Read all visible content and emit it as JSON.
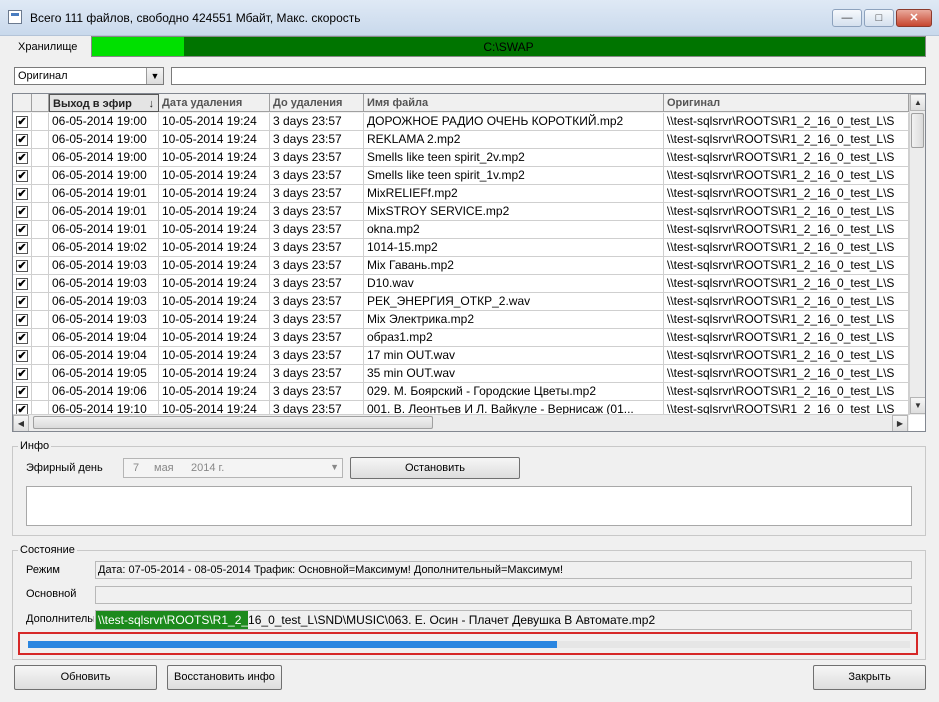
{
  "window": {
    "title": "Всего 111 файлов, свободно 424551 Мбайт, Макс. скорость"
  },
  "storage": {
    "label": "Хранилище",
    "path": "C:\\SWAP",
    "used_fraction": 0.11,
    "colors": {
      "used": "#00e000",
      "free": "#007400"
    }
  },
  "filter": {
    "selected": "Оригинал",
    "text": ""
  },
  "grid": {
    "columns": [
      "",
      "Выход в эфир",
      "Дата удаления",
      "До удаления",
      "Имя файла",
      "Оригинал"
    ],
    "sorted_column": "Выход в эфир",
    "rows": [
      [
        "06-05-2014  19:00",
        "10-05-2014  19:24",
        "3 days 23:57",
        "ДОРОЖНОЕ РАДИО ОЧЕНЬ КОРОТКИЙ.mp2",
        "\\\\test-sqlsrvr\\ROOTS\\R1_2_16_0_test_L\\S"
      ],
      [
        "06-05-2014  19:00",
        "10-05-2014  19:24",
        "3 days 23:57",
        "REKLAMA 2.mp2",
        "\\\\test-sqlsrvr\\ROOTS\\R1_2_16_0_test_L\\S"
      ],
      [
        "06-05-2014  19:00",
        "10-05-2014  19:24",
        "3 days 23:57",
        "Smells like teen spirit_2v.mp2",
        "\\\\test-sqlsrvr\\ROOTS\\R1_2_16_0_test_L\\S"
      ],
      [
        "06-05-2014  19:00",
        "10-05-2014  19:24",
        "3 days 23:57",
        "Smells like teen spirit_1v.mp2",
        "\\\\test-sqlsrvr\\ROOTS\\R1_2_16_0_test_L\\S"
      ],
      [
        "06-05-2014  19:01",
        "10-05-2014  19:24",
        "3 days 23:57",
        "MixRELIEFf.mp2",
        "\\\\test-sqlsrvr\\ROOTS\\R1_2_16_0_test_L\\S"
      ],
      [
        "06-05-2014  19:01",
        "10-05-2014  19:24",
        "3 days 23:57",
        "MixSTROY SERVICE.mp2",
        "\\\\test-sqlsrvr\\ROOTS\\R1_2_16_0_test_L\\S"
      ],
      [
        "06-05-2014  19:01",
        "10-05-2014  19:24",
        "3 days 23:57",
        "okna.mp2",
        "\\\\test-sqlsrvr\\ROOTS\\R1_2_16_0_test_L\\S"
      ],
      [
        "06-05-2014  19:02",
        "10-05-2014  19:24",
        "3 days 23:57",
        "1014-15.mp2",
        "\\\\test-sqlsrvr\\ROOTS\\R1_2_16_0_test_L\\S"
      ],
      [
        "06-05-2014  19:03",
        "10-05-2014  19:24",
        "3 days 23:57",
        "Mix Гавань.mp2",
        "\\\\test-sqlsrvr\\ROOTS\\R1_2_16_0_test_L\\S"
      ],
      [
        "06-05-2014  19:03",
        "10-05-2014  19:24",
        "3 days 23:57",
        "D10.wav",
        "\\\\test-sqlsrvr\\ROOTS\\R1_2_16_0_test_L\\S"
      ],
      [
        "06-05-2014  19:03",
        "10-05-2014  19:24",
        "3 days 23:57",
        "РЕК_ЭНЕРГИЯ_ОТКР_2.wav",
        "\\\\test-sqlsrvr\\ROOTS\\R1_2_16_0_test_L\\S"
      ],
      [
        "06-05-2014  19:03",
        "10-05-2014  19:24",
        "3 days 23:57",
        "Mix Электрика.mp2",
        "\\\\test-sqlsrvr\\ROOTS\\R1_2_16_0_test_L\\S"
      ],
      [
        "06-05-2014  19:04",
        "10-05-2014  19:24",
        "3 days 23:57",
        "образ1.mp2",
        "\\\\test-sqlsrvr\\ROOTS\\R1_2_16_0_test_L\\S"
      ],
      [
        "06-05-2014  19:04",
        "10-05-2014  19:24",
        "3 days 23:57",
        "17 min OUT.wav",
        "\\\\test-sqlsrvr\\ROOTS\\R1_2_16_0_test_L\\S"
      ],
      [
        "06-05-2014  19:05",
        "10-05-2014  19:24",
        "3 days 23:57",
        "35 min OUT.wav",
        "\\\\test-sqlsrvr\\ROOTS\\R1_2_16_0_test_L\\S"
      ],
      [
        "06-05-2014  19:06",
        "10-05-2014  19:24",
        "3 days 23:57",
        "029. М. Боярский - Городские Цветы.mp2",
        "\\\\test-sqlsrvr\\ROOTS\\R1_2_16_0_test_L\\S"
      ],
      [
        "06-05-2014  19:10",
        "10-05-2014  19:24",
        "3 days 23:57",
        "001. В. Леонтьев И Л. Вайкуле - Вернисаж  (01...",
        "\\\\test-sqlsrvr\\ROOTS\\R1_2_16_0_test_L\\S"
      ]
    ]
  },
  "info": {
    "group_label": "Инфо",
    "air_day_label": "Эфирный день",
    "air_day": {
      "day": "7",
      "month": "мая",
      "year": "2014 г."
    },
    "stop_button": "Остановить",
    "text": ""
  },
  "state": {
    "group_label": "Состояние",
    "mode_label": "Режим",
    "mode_value": "Дата: 07-05-2014  - 08-05-2014  Трафик: Основной=Максимум! Дополнительный=Максимум!",
    "main_label": "Основной",
    "main_value": "",
    "extra_label": "Дополнительный",
    "extra_value_highlight": "\\\\test-sqlsrvr\\ROOTS\\R1_2_",
    "extra_value_rest": "16_0_test_L\\SND\\MUSIC\\063. Е. Осин - Плачет Девушка В Автомате.mp2",
    "progress": 0.6,
    "colors": {
      "progress": "#2b86e0",
      "highlight": "#1c8a1c",
      "frame": "#d62828"
    }
  },
  "buttons": {
    "refresh": "Обновить",
    "restore_info": "Восстановить инфо",
    "close": "Закрыть"
  }
}
